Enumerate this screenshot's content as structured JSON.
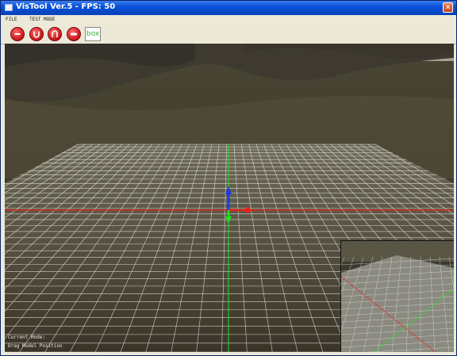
{
  "window": {
    "title": "VisTool Ver.5 - FPS: 50"
  },
  "menu": {
    "items": [
      "FILE",
      "TEST MODE"
    ]
  },
  "toolbar": {
    "buttons": [
      "minus-icon",
      "u-shape-icon",
      "arch-icon",
      "bar-icon"
    ],
    "box_label": "box"
  },
  "status": {
    "line1": "Current Mode:",
    "line2": "Drag Model Position"
  },
  "colors": {
    "accent": "#d8141a",
    "axis_x": "#e8201a",
    "axis_y": "#1ee81e",
    "axis_z": "#1a3ae8",
    "grid": "#ffffff"
  }
}
